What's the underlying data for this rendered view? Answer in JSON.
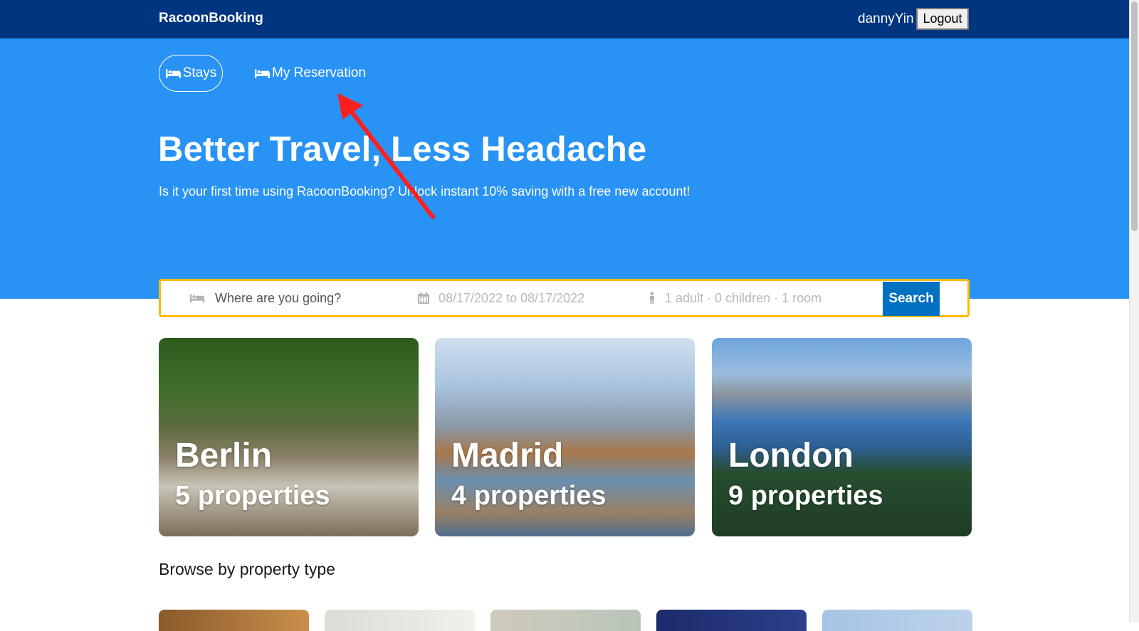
{
  "header": {
    "brand": "RacoonBooking",
    "username": "dannyYin",
    "logout_label": "Logout"
  },
  "nav": {
    "tabs": [
      {
        "label": "Stays",
        "icon": "bed-icon",
        "active": true
      },
      {
        "label": "My Reservation",
        "icon": "bed-icon",
        "active": false
      }
    ]
  },
  "hero": {
    "title": "Better Travel, Less Headache",
    "subtitle": "Is it your first time using RacoonBooking? Unlock instant 10% saving with a free new account!"
  },
  "search": {
    "destination_placeholder": "Where are you going?",
    "destination_value": "",
    "dates": "08/17/2022 to 08/17/2022",
    "guests": "1 adult · 0 children · 1 room",
    "button_label": "Search",
    "icons": [
      "bed-icon",
      "calendar-icon",
      "person-icon"
    ]
  },
  "cities": [
    {
      "name": "Berlin",
      "properties": "5 properties"
    },
    {
      "name": "Madrid",
      "properties": "4 properties"
    },
    {
      "name": "London",
      "properties": "9 properties"
    }
  ],
  "browse": {
    "title": "Browse by property type"
  },
  "colors": {
    "topbar": "#003580",
    "hero": "#2893f4",
    "search_border": "#febb02",
    "search_button": "#0071c2",
    "annotation_arrow": "#ff1f1f"
  }
}
